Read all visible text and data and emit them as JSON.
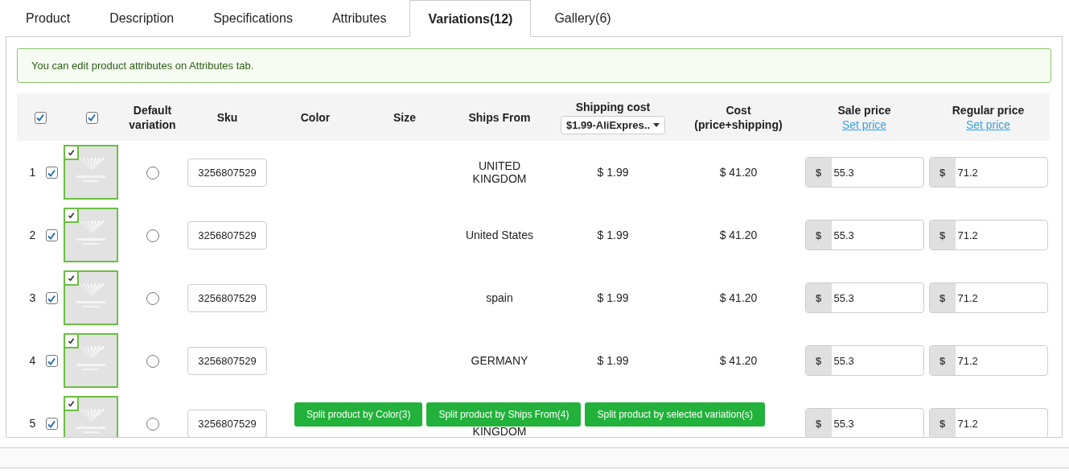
{
  "tabs": [
    {
      "label": "Product",
      "selected": false
    },
    {
      "label": "Description",
      "selected": false
    },
    {
      "label": "Specifications",
      "selected": false
    },
    {
      "label": "Attributes",
      "selected": false
    },
    {
      "label": "Variations(12)",
      "selected": true
    },
    {
      "label": "Gallery(6)",
      "selected": false
    }
  ],
  "notice": "You can edit product attributes on Attributes tab.",
  "table": {
    "columns": [
      {
        "kind": "checkbox",
        "checked": true
      },
      {
        "kind": "checkbox",
        "checked": true
      },
      {
        "kind": "text",
        "label": "Default variation"
      },
      {
        "kind": "text",
        "label": "Sku"
      },
      {
        "kind": "text",
        "label": "Color"
      },
      {
        "kind": "text",
        "label": "Size"
      },
      {
        "kind": "text",
        "label": "Ships From"
      },
      {
        "kind": "select",
        "label": "Shipping cost",
        "value": "$1.99-AliExpres.."
      },
      {
        "kind": "text",
        "label": "Cost (price+shipping)"
      },
      {
        "kind": "link",
        "label": "Sale price",
        "link": "Set price"
      },
      {
        "kind": "link",
        "label": "Regular price",
        "link": "Set price"
      }
    ],
    "rows": [
      {
        "number": "1",
        "checked": true,
        "image_checked": true,
        "selected": false,
        "sku": "3256807529",
        "ships_from": "UNITED KINGDOM",
        "partly_hidden": false,
        "shipping": "$ 1.99",
        "cost": "$ 41.20",
        "sale_currency": "$",
        "sale_price": "55.3",
        "regular_currency": "$",
        "regular_price": "71.2"
      },
      {
        "number": "2",
        "checked": true,
        "image_checked": true,
        "selected": false,
        "sku": "3256807529",
        "ships_from": "United States",
        "partly_hidden": false,
        "shipping": "$ 1.99",
        "cost": "$ 41.20",
        "sale_currency": "$",
        "sale_price": "55.3",
        "regular_currency": "$",
        "regular_price": "71.2"
      },
      {
        "number": "3",
        "checked": true,
        "image_checked": true,
        "selected": false,
        "sku": "3256807529",
        "ships_from": "spain",
        "partly_hidden": false,
        "shipping": "$ 1.99",
        "cost": "$ 41.20",
        "sale_currency": "$",
        "sale_price": "55.3",
        "regular_currency": "$",
        "regular_price": "71.2"
      },
      {
        "number": "4",
        "checked": true,
        "image_checked": true,
        "selected": false,
        "sku": "3256807529",
        "ships_from": "GERMANY",
        "partly_hidden": false,
        "shipping": "$ 1.99",
        "cost": "$ 41.20",
        "sale_currency": "$",
        "sale_price": "55.3",
        "regular_currency": "$",
        "regular_price": "71.2"
      },
      {
        "number": "5",
        "checked": true,
        "image_checked": true,
        "selected": false,
        "sku": "3256807529",
        "ships_from": "KINGDOM",
        "partly_hidden": true,
        "sale_currency": "$",
        "sale_price": "55.3",
        "regular_currency": "$",
        "regular_price": "71.2"
      }
    ]
  },
  "buttons": [
    "Split product by Color(3)",
    "Split product by Ships From(4)",
    "Split product by selected variation(s)"
  ]
}
